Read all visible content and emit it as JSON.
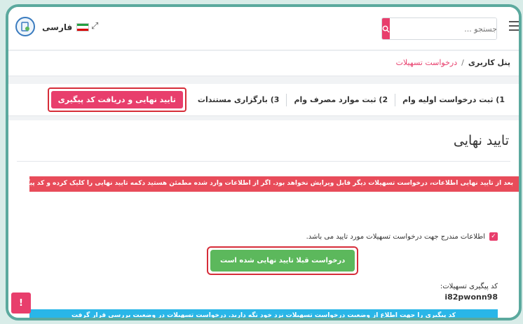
{
  "header": {
    "language_label": "فارسی",
    "search_placeholder": "جستجو ...",
    "icons": {
      "logo": "document-badge-icon",
      "expand": "expand-arrows-icon",
      "search": "search-icon",
      "menu": "hamburger-menu-icon"
    },
    "colors": {
      "accent": "#e83e6c"
    }
  },
  "breadcrumb": {
    "root": "پنل کاربری",
    "separator": "/",
    "current": "درخواست تسهیلات"
  },
  "steps": [
    {
      "label": "1) ثبت درخواست اولیه وام"
    },
    {
      "label": "2) ثبت موارد مصرف وام"
    },
    {
      "label": "3) بارگزاری مستندات"
    }
  ],
  "active_step": {
    "label": "تایید نهایی و دریافت کد پیگیری"
  },
  "panel": {
    "title": "تایید نهایی",
    "warning": "بعد از تایید نهایی اطلاعات، درخواست تسهیلات دیگر قابل ویرایش نخواهد بود. اگر از اطلاعات وارد شده مطمئن هستید دکمه تایید نهایی را کلیک کرده و کد پیگیری را دریافت نمائید",
    "confirm_label": "اطلاعات مندرج جهت درخواست تسهیلات مورد تایید می باشد.",
    "confirm_checked": true,
    "submit_button": "درخواست قبلا تایید نهایی شده است",
    "tracking_label": "کد پیگیری تسهیلات:",
    "tracking_code": "i82pwonn98",
    "info": "کد پیگیری را جهت اطلاع از وضعیت درخواست تسهیلات نزد خود نگه دارید. درخواست تسهیلات در وضعیت بررسی قرار گرفت",
    "float_button": "!"
  }
}
